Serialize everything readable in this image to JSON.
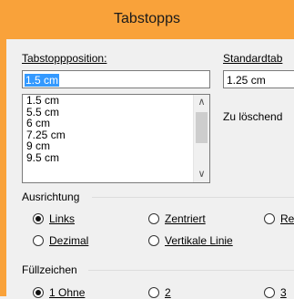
{
  "window": {
    "title": "Tabstopps"
  },
  "tab_position": {
    "label": "Tabstoppposition:",
    "value": "1.5 cm"
  },
  "default_tab": {
    "label": "Standardtab",
    "value": "1.25 cm"
  },
  "to_delete": {
    "label": "Zu löschend"
  },
  "list": {
    "items": [
      "1.5 cm",
      "5.5 cm",
      "6 cm",
      "7.25 cm",
      "9 cm",
      "9.5 cm"
    ]
  },
  "alignment": {
    "header": "Ausrichtung",
    "options": [
      "Links",
      "Zentriert",
      "Re",
      "Dezimal",
      "Vertikale Linie"
    ]
  },
  "leader": {
    "header": "Füllzeichen",
    "options": [
      "1 Ohne",
      "2",
      "3"
    ]
  },
  "colors": {
    "title_bar": "#f9a23a",
    "selection": "#3399ff"
  }
}
